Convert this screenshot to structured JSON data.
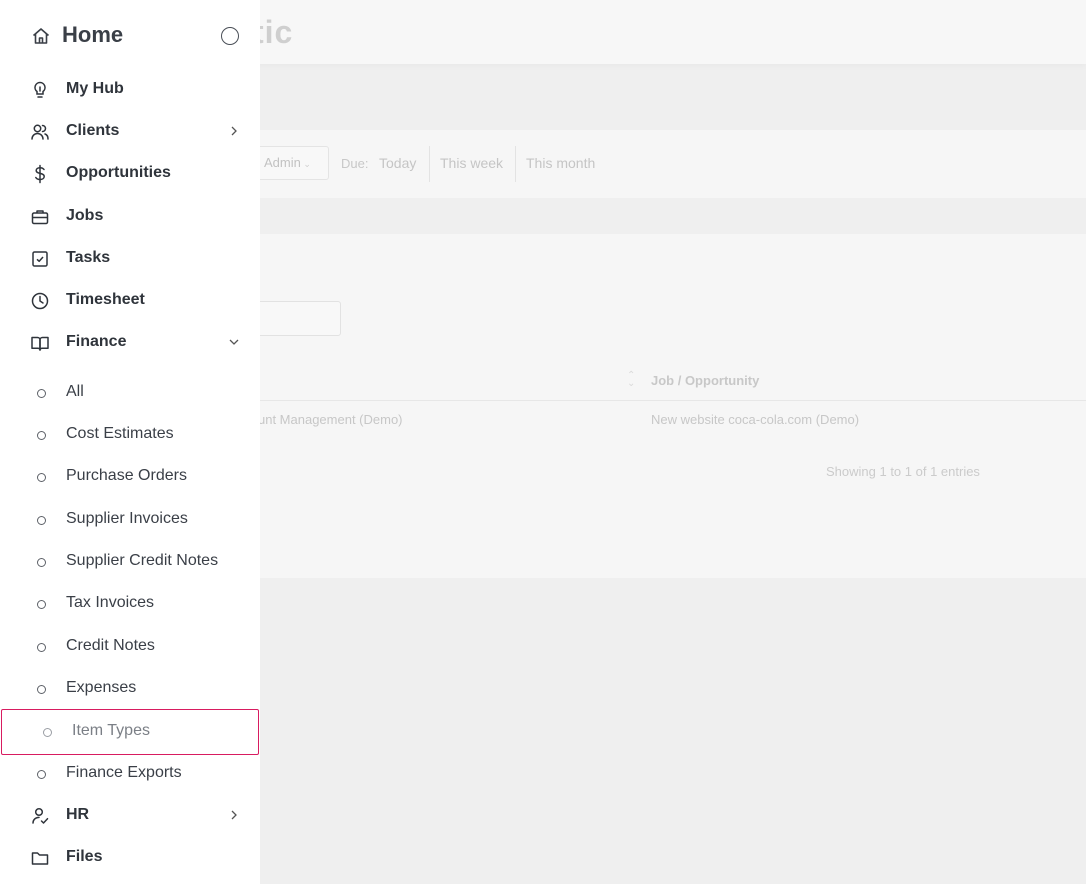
{
  "background": {
    "logo_partial": "tic",
    "filter_owner": "Admin",
    "due_label": "Due:",
    "due_options": [
      "Today",
      "This week",
      "This month"
    ],
    "table_header_job": "Job / Opportunity",
    "row_client": "unt Management (Demo)",
    "row_job": "New website coca-cola.com (Demo)",
    "showing_text": "Showing 1 to 1 of 1 entries"
  },
  "sidebar": {
    "home_label": "Home",
    "items": [
      {
        "label": "My Hub",
        "icon": "lightbulb-icon"
      },
      {
        "label": "Clients",
        "icon": "users-icon"
      },
      {
        "label": "Opportunities",
        "icon": "dollar-icon"
      },
      {
        "label": "Jobs",
        "icon": "briefcase-icon"
      },
      {
        "label": "Tasks",
        "icon": "checkbox-icon"
      },
      {
        "label": "Timesheet",
        "icon": "clock-icon"
      },
      {
        "label": "Finance",
        "icon": "book-icon"
      }
    ],
    "finance_sub": [
      "All",
      "Cost Estimates",
      "Purchase Orders",
      "Supplier Invoices",
      "Supplier Credit Notes",
      "Tax Invoices",
      "Credit Notes",
      "Expenses",
      "Item Types",
      "Finance Exports"
    ],
    "bottom_items": [
      {
        "label": "HR",
        "icon": "user-check-icon"
      },
      {
        "label": "Files",
        "icon": "folder-icon"
      }
    ],
    "active_sub": "Item Types",
    "accent_color": "#d81b60"
  }
}
